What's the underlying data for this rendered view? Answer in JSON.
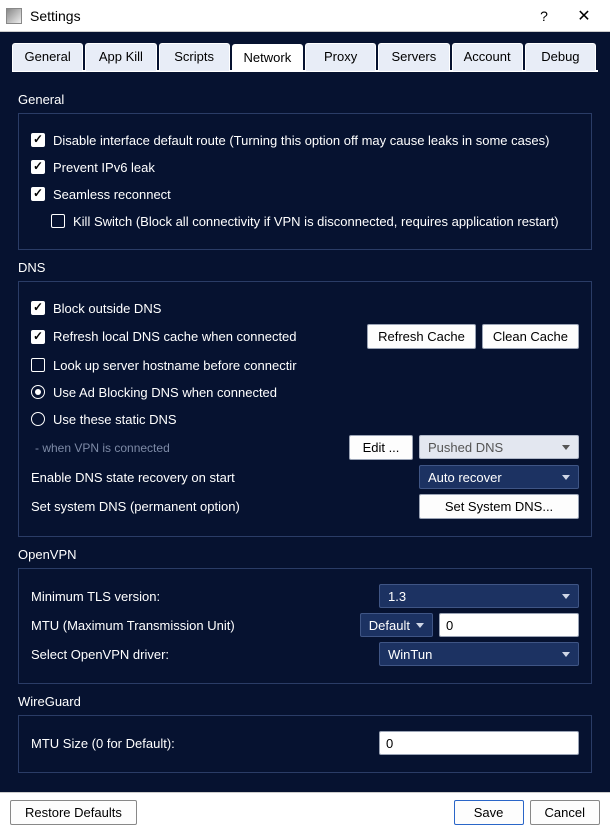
{
  "window": {
    "title": "Settings",
    "help_glyph": "?",
    "close_glyph": "✕"
  },
  "tabs": [
    {
      "label": "General"
    },
    {
      "label": "App Kill"
    },
    {
      "label": "Scripts"
    },
    {
      "label": "Network"
    },
    {
      "label": "Proxy"
    },
    {
      "label": "Servers"
    },
    {
      "label": "Account"
    },
    {
      "label": "Debug"
    }
  ],
  "sections": {
    "general": {
      "title": "General",
      "disable_route": {
        "label": "Disable interface default route (Turning this option off may cause leaks in some cases)",
        "checked": true
      },
      "prevent_ipv6": {
        "label": "Prevent IPv6 leak",
        "checked": true
      },
      "seamless": {
        "label": "Seamless reconnect",
        "checked": true
      },
      "killswitch": {
        "label": "Kill Switch (Block all connectivity if VPN is disconnected, requires application restart)",
        "checked": false
      }
    },
    "dns": {
      "title": "DNS",
      "block_outside": {
        "label": "Block outside DNS",
        "checked": true
      },
      "refresh_local": {
        "label": "Refresh local DNS cache when connected",
        "checked": true
      },
      "refresh_cache_btn": "Refresh Cache",
      "clean_cache_btn": "Clean Cache",
      "lookup": {
        "label": "Look up server hostname before connectir",
        "checked": false
      },
      "dns_mode": {
        "adblock": "Use Ad Blocking DNS when connected",
        "static": "Use these static DNS",
        "selected": "adblock"
      },
      "when_connected_hint": "- when VPN is connected",
      "edit_btn": "Edit ...",
      "pushed_combo": "Pushed DNS",
      "recovery_label": "Enable DNS state recovery on start",
      "recovery_value": "Auto recover",
      "set_system_label": "Set system DNS (permanent option)",
      "set_system_btn": "Set System DNS..."
    },
    "openvpn": {
      "title": "OpenVPN",
      "tls_label": "Minimum TLS version:",
      "tls_value": "1.3",
      "mtu_label": "MTU (Maximum Transmission Unit)",
      "mtu_mode": "Default",
      "mtu_value": "0",
      "driver_label": "Select OpenVPN driver:",
      "driver_value": "WinTun"
    },
    "wireguard": {
      "title": "WireGuard",
      "mtu_label": "MTU Size (0 for Default):",
      "mtu_value": "0"
    }
  },
  "footer": {
    "restore": "Restore Defaults",
    "save": "Save",
    "cancel": "Cancel"
  }
}
